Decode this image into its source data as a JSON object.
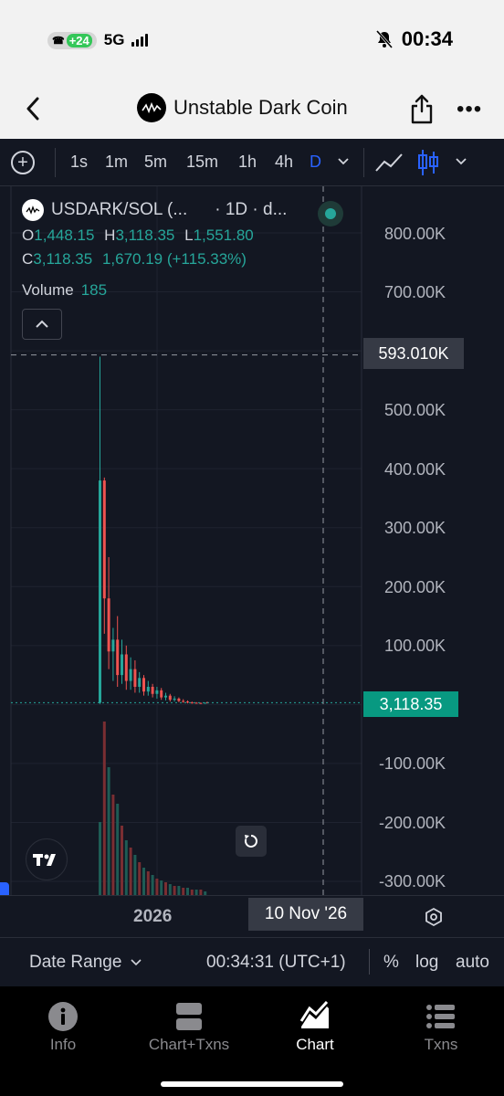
{
  "status_bar": {
    "call_badge": "+24",
    "network": "5G",
    "time": "00:34"
  },
  "nav": {
    "title": "Unstable Dark Coin"
  },
  "toolbar": {
    "intervals": [
      "1s",
      "1m",
      "5m",
      "15m",
      "1h",
      "4h",
      "D"
    ],
    "active_interval": "D"
  },
  "legend": {
    "symbol": "USDARK/SOL (...",
    "interval": "· 1D · d...",
    "o_label": "O",
    "o": "1,448.15",
    "h_label": "H",
    "h": "3,118.35",
    "l_label": "L",
    "l": "1,551.80",
    "c_label": "C",
    "c": "3,118.35",
    "change": "1,670.19 (+115.33%)",
    "volume_label": "Volume",
    "volume": "185"
  },
  "y_axis": {
    "labels": [
      "800.00K",
      "700.00K",
      "500.00K",
      "400.00K",
      "300.00K",
      "200.00K",
      "100.00K",
      "-100.00K",
      "-200.00K",
      "-300.00K"
    ],
    "crosshair_value": "593.010K",
    "last_price": "3,118.35"
  },
  "x_axis": {
    "year_label": "2026",
    "crosshair_date": "10 Nov '26"
  },
  "bottom_bar": {
    "date_range": "Date Range",
    "clock": "00:34:31 (UTC+1)",
    "percent": "%",
    "log": "log",
    "auto": "auto"
  },
  "tabs": [
    {
      "label": "Info",
      "icon": "info-icon"
    },
    {
      "label": "Chart+Txns",
      "icon": "split-view-icon"
    },
    {
      "label": "Chart",
      "icon": "chart-icon"
    },
    {
      "label": "Txns",
      "icon": "list-icon"
    }
  ],
  "active_tab": "Chart",
  "colors": {
    "up": "#26a69a",
    "down": "#ef5350",
    "background": "#131722",
    "accent": "#2962ff"
  },
  "chart_data": {
    "type": "candlestick",
    "x_label_shown": "2026",
    "ylim": [
      -300000,
      800000
    ],
    "y_ticks": [
      800000,
      700000,
      500000,
      400000,
      300000,
      200000,
      100000,
      -100000,
      -200000,
      -300000
    ],
    "candles": [
      {
        "o": 3000,
        "h": 590000,
        "l": 1000,
        "c": 380000
      },
      {
        "o": 380000,
        "h": 385000,
        "l": 120000,
        "c": 180000
      },
      {
        "o": 180000,
        "h": 250000,
        "l": 60000,
        "c": 90000
      },
      {
        "o": 90000,
        "h": 130000,
        "l": 40000,
        "c": 110000
      },
      {
        "o": 110000,
        "h": 150000,
        "l": 30000,
        "c": 50000
      },
      {
        "o": 50000,
        "h": 110000,
        "l": 35000,
        "c": 85000
      },
      {
        "o": 85000,
        "h": 100000,
        "l": 25000,
        "c": 40000
      },
      {
        "o": 40000,
        "h": 80000,
        "l": 25000,
        "c": 60000
      },
      {
        "o": 60000,
        "h": 75000,
        "l": 20000,
        "c": 30000
      },
      {
        "o": 30000,
        "h": 55000,
        "l": 20000,
        "c": 45000
      },
      {
        "o": 45000,
        "h": 50000,
        "l": 15000,
        "c": 22000
      },
      {
        "o": 22000,
        "h": 40000,
        "l": 15000,
        "c": 30000
      },
      {
        "o": 30000,
        "h": 35000,
        "l": 12000,
        "c": 18000
      },
      {
        "o": 18000,
        "h": 30000,
        "l": 10000,
        "c": 24000
      },
      {
        "o": 24000,
        "h": 28000,
        "l": 8000,
        "c": 12000
      },
      {
        "o": 12000,
        "h": 20000,
        "l": 7000,
        "c": 15000
      },
      {
        "o": 15000,
        "h": 18000,
        "l": 5000,
        "c": 8000
      },
      {
        "o": 8000,
        "h": 14000,
        "l": 5000,
        "c": 10000
      },
      {
        "o": 10000,
        "h": 12000,
        "l": 4000,
        "c": 6000
      },
      {
        "o": 6000,
        "h": 9000,
        "l": 3000,
        "c": 5000
      },
      {
        "o": 5000,
        "h": 7000,
        "l": 2000,
        "c": 3500
      },
      {
        "o": 3500,
        "h": 5000,
        "l": 1500,
        "c": 3000
      },
      {
        "o": 3000,
        "h": 4000,
        "l": 1500,
        "c": 2500
      },
      {
        "o": 2500,
        "h": 3500,
        "l": 1500,
        "c": 1500
      },
      {
        "o": 1448.15,
        "h": 3118.35,
        "l": 1551.8,
        "c": 3118.35
      }
    ],
    "volume": [
      40,
      95,
      70,
      55,
      50,
      38,
      30,
      26,
      22,
      18,
      15,
      13,
      11,
      9,
      8,
      7,
      6,
      5,
      5,
      4,
      4,
      3,
      3,
      3,
      2
    ],
    "last_price": 3118.35,
    "crosshair_price": 593010
  }
}
